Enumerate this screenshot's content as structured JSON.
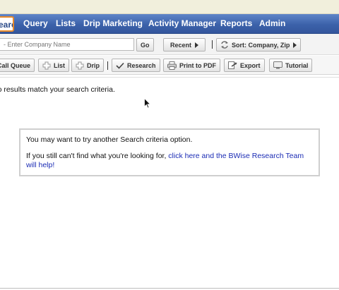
{
  "nav": {
    "tabs": [
      {
        "label": "Search",
        "active": true
      },
      {
        "label": "Query"
      },
      {
        "label": "Lists"
      },
      {
        "label": "Drip Marketing"
      },
      {
        "label": "Activity Manager"
      },
      {
        "label": "Reports"
      },
      {
        "label": "Admin"
      }
    ]
  },
  "searchbar": {
    "company_placeholder": "- Enter Company Name",
    "go_label": "Go",
    "recent_label": "Recent",
    "sort_label": "Sort: Company, Zip"
  },
  "toolbar": {
    "call_queue_label": "Call Queue",
    "list_label": "List",
    "drip_label": "Drip",
    "research_label": "Research",
    "print_label": "Print to PDF",
    "export_label": "Export",
    "tutorial_label": "Tutorial"
  },
  "content": {
    "criteria_text": "No results match your search criteria.",
    "message_line1": "You may want to try another Search criteria option.",
    "message_line2_prefix": "If you still can't find what you're looking for, ",
    "message_link": "click here and the BWise Research Team will help!"
  },
  "colors": {
    "nav_blue": "#3c62aa",
    "active_tab_border": "#e88a2a",
    "link_blue": "#1a2bb4"
  }
}
